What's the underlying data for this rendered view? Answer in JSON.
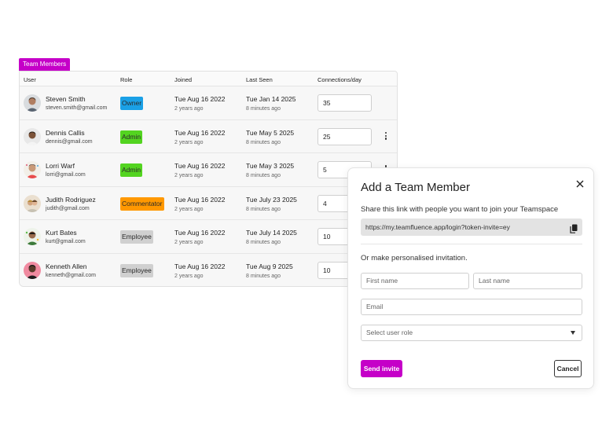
{
  "tag": "Team Members",
  "columns": [
    "User",
    "Role",
    "Joined",
    "Last Seen",
    "Connections/day"
  ],
  "members": [
    {
      "name": "Steven Smith",
      "email": "steven.smith@gmail.com",
      "role": "Owner",
      "role_color": "#1aa0e6",
      "joined": "Tue Aug 16 2022",
      "joined_ago": "2 years ago",
      "last_seen": "Tue Jan 14 2025",
      "last_seen_ago": "8 minutes ago",
      "connections": "35",
      "menu": false
    },
    {
      "name": "Dennis Callis",
      "email": "dennis@gmail.com",
      "role": "Admin",
      "role_color": "#53d420",
      "joined": "Tue Aug 16 2022",
      "joined_ago": "2 years ago",
      "last_seen": "Tue May 5 2025",
      "last_seen_ago": "8 minutes ago",
      "connections": "25",
      "menu": true
    },
    {
      "name": "Lorri Warf",
      "email": "lorri@gmail.com",
      "role": "Admin",
      "role_color": "#53d420",
      "joined": "Tue Aug 16 2022",
      "joined_ago": "2 years ago",
      "last_seen": "Tue May 3 2025",
      "last_seen_ago": "8 minutes ago",
      "connections": "5",
      "menu": true
    },
    {
      "name": "Judith Rodriguez",
      "email": "judith@gmail.com",
      "role": "Commentator",
      "role_color": "#ff9800",
      "joined": "Tue Aug 16 2022",
      "joined_ago": "2 years ago",
      "last_seen": "Tue July 23 2025",
      "last_seen_ago": "8 minutes ago",
      "connections": "4",
      "menu": false
    },
    {
      "name": "Kurt Bates",
      "email": "kurt@gmail.com",
      "role": "Employee",
      "role_color": "#d0d0d0",
      "joined": "Tue Aug 16 2022",
      "joined_ago": "2 years ago",
      "last_seen": "Tue July 14 2025",
      "last_seen_ago": "8 minutes ago",
      "connections": "10",
      "menu": false
    },
    {
      "name": "Kenneth Allen",
      "email": "kenneth@gmail.com",
      "role": "Employee",
      "role_color": "#d0d0d0",
      "joined": "Tue Aug 16 2022",
      "joined_ago": "2 years ago",
      "last_seen": "Tue Aug 9 2025",
      "last_seen_ago": "8 minutes ago",
      "connections": "10",
      "menu": false
    }
  ],
  "modal": {
    "title": "Add a Team Member",
    "share_text": "Share this link with people you want to join your Teamspace",
    "link": "https://my.teamfluence.app/login?token-invite=ey",
    "or_text": "Or make personalised invitation.",
    "first_name_placeholder": "First name",
    "last_name_placeholder": "Last name",
    "email_placeholder": "Email",
    "role_placeholder": "Select user role",
    "send_label": "Send invite",
    "cancel_label": "Cancel"
  },
  "accent_color": "#c500c8"
}
